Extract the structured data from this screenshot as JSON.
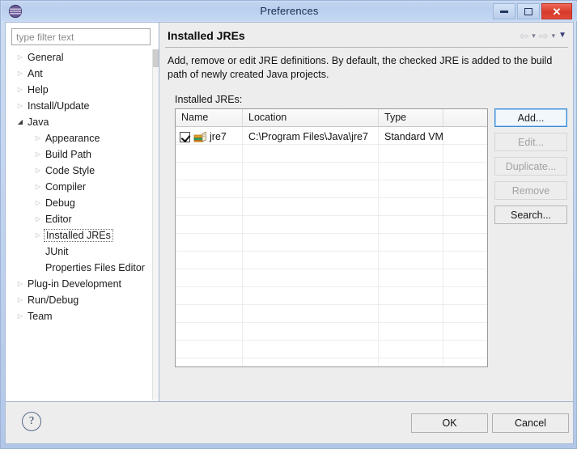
{
  "window": {
    "title": "Preferences",
    "app_icon": "eclipse-sphere-icon",
    "controls": {
      "minimize": "minimize-icon",
      "maximize": "maximize-icon",
      "close": "✕"
    }
  },
  "sidebar": {
    "filter": {
      "value": "",
      "placeholder": "type filter text"
    },
    "items": [
      {
        "label": "General",
        "level": 0,
        "twisty": "collapsed",
        "selected": false
      },
      {
        "label": "Ant",
        "level": 0,
        "twisty": "collapsed",
        "selected": false
      },
      {
        "label": "Help",
        "level": 0,
        "twisty": "collapsed",
        "selected": false
      },
      {
        "label": "Install/Update",
        "level": 0,
        "twisty": "collapsed",
        "selected": false
      },
      {
        "label": "Java",
        "level": 0,
        "twisty": "expanded",
        "selected": false
      },
      {
        "label": "Appearance",
        "level": 1,
        "twisty": "collapsed",
        "selected": false
      },
      {
        "label": "Build Path",
        "level": 1,
        "twisty": "collapsed",
        "selected": false
      },
      {
        "label": "Code Style",
        "level": 1,
        "twisty": "collapsed",
        "selected": false
      },
      {
        "label": "Compiler",
        "level": 1,
        "twisty": "collapsed",
        "selected": false
      },
      {
        "label": "Debug",
        "level": 1,
        "twisty": "collapsed",
        "selected": false
      },
      {
        "label": "Editor",
        "level": 1,
        "twisty": "collapsed",
        "selected": false
      },
      {
        "label": "Installed JREs",
        "level": 1,
        "twisty": "collapsed",
        "selected": true
      },
      {
        "label": "JUnit",
        "level": 1,
        "twisty": "none",
        "selected": false
      },
      {
        "label": "Properties Files Editor",
        "level": 1,
        "twisty": "none",
        "selected": false
      },
      {
        "label": "Plug-in Development",
        "level": 0,
        "twisty": "collapsed",
        "selected": false
      },
      {
        "label": "Run/Debug",
        "level": 0,
        "twisty": "collapsed",
        "selected": false
      },
      {
        "label": "Team",
        "level": 0,
        "twisty": "collapsed",
        "selected": false
      }
    ]
  },
  "content": {
    "page_title": "Installed JREs",
    "description": "Add, remove or edit JRE definitions. By default, the checked JRE is added to the build path of newly created Java projects.",
    "list_label": "Installed JREs:",
    "nav": {
      "back_icon": "arrow-left-icon",
      "back_caret": "▾",
      "forward_icon": "arrow-right-icon",
      "forward_caret": "▾",
      "menu_caret": "▼"
    },
    "table": {
      "columns": [
        "Name",
        "Location",
        "Type",
        ""
      ],
      "rows": [
        {
          "checked": true,
          "icon": "jre-library-icon",
          "name": "jre7",
          "location": "C:\\Program Files\\Java\\jre7",
          "type": "Standard VM",
          "extra": ""
        }
      ],
      "empty_row_count": 13
    },
    "side_buttons": [
      {
        "label": "Add...",
        "state": "focused"
      },
      {
        "label": "Edit...",
        "state": "disabled"
      },
      {
        "label": "Duplicate...",
        "state": "disabled"
      },
      {
        "label": "Remove",
        "state": "disabled"
      },
      {
        "label": "Search...",
        "state": "enabled"
      }
    ]
  },
  "footer": {
    "help_icon": "?",
    "ok_label": "OK",
    "cancel_label": "Cancel"
  },
  "colors": {
    "titlebar_accent": "#bfd2ee",
    "close_button": "#d5392a",
    "focus_border": "#3a8bd8",
    "panel_bg": "#ededed",
    "list_bg": "#ffffff"
  }
}
